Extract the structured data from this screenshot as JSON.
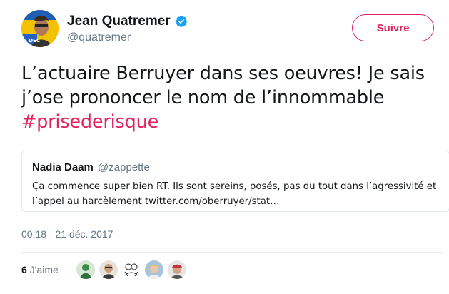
{
  "author": {
    "display_name": "Jean Quatremer",
    "handle": "@quatremer",
    "verified_icon": "verified-badge-icon",
    "avatar_badge_text": "5 DEC"
  },
  "follow_button": {
    "label": "Suivre"
  },
  "tweet": {
    "text_line1": "L’actuaire Berruyer dans ses oeuvres! Je sais",
    "text_line2": "j’ose prononcer le nom de l’innommable",
    "hashtag": "#prisederisque"
  },
  "quoted_tweet": {
    "display_name": "Nadia Daam",
    "handle": "@zappette",
    "text": "Ça commence super bien RT. Ils sont sereins, posés, pas du tout dans l’agressivité et l’appel au harcèlement twitter.com/oberruyer/stat…"
  },
  "timestamp": "00:18 - 21 déc. 2017",
  "likes": {
    "count": "6",
    "label": "J'aime",
    "likers": [
      {
        "name": "liker-1",
        "icon": "avatar-green"
      },
      {
        "name": "liker-2",
        "icon": "avatar-portrait"
      },
      {
        "name": "liker-3",
        "icon": "avatar-sketch"
      },
      {
        "name": "liker-4",
        "icon": "avatar-blonde"
      },
      {
        "name": "liker-5",
        "icon": "avatar-redcap"
      }
    ]
  },
  "colors": {
    "accent": "#e0245e",
    "secondary_text": "#657786",
    "verified": "#1da1f2",
    "border": "#e1e8ed"
  }
}
